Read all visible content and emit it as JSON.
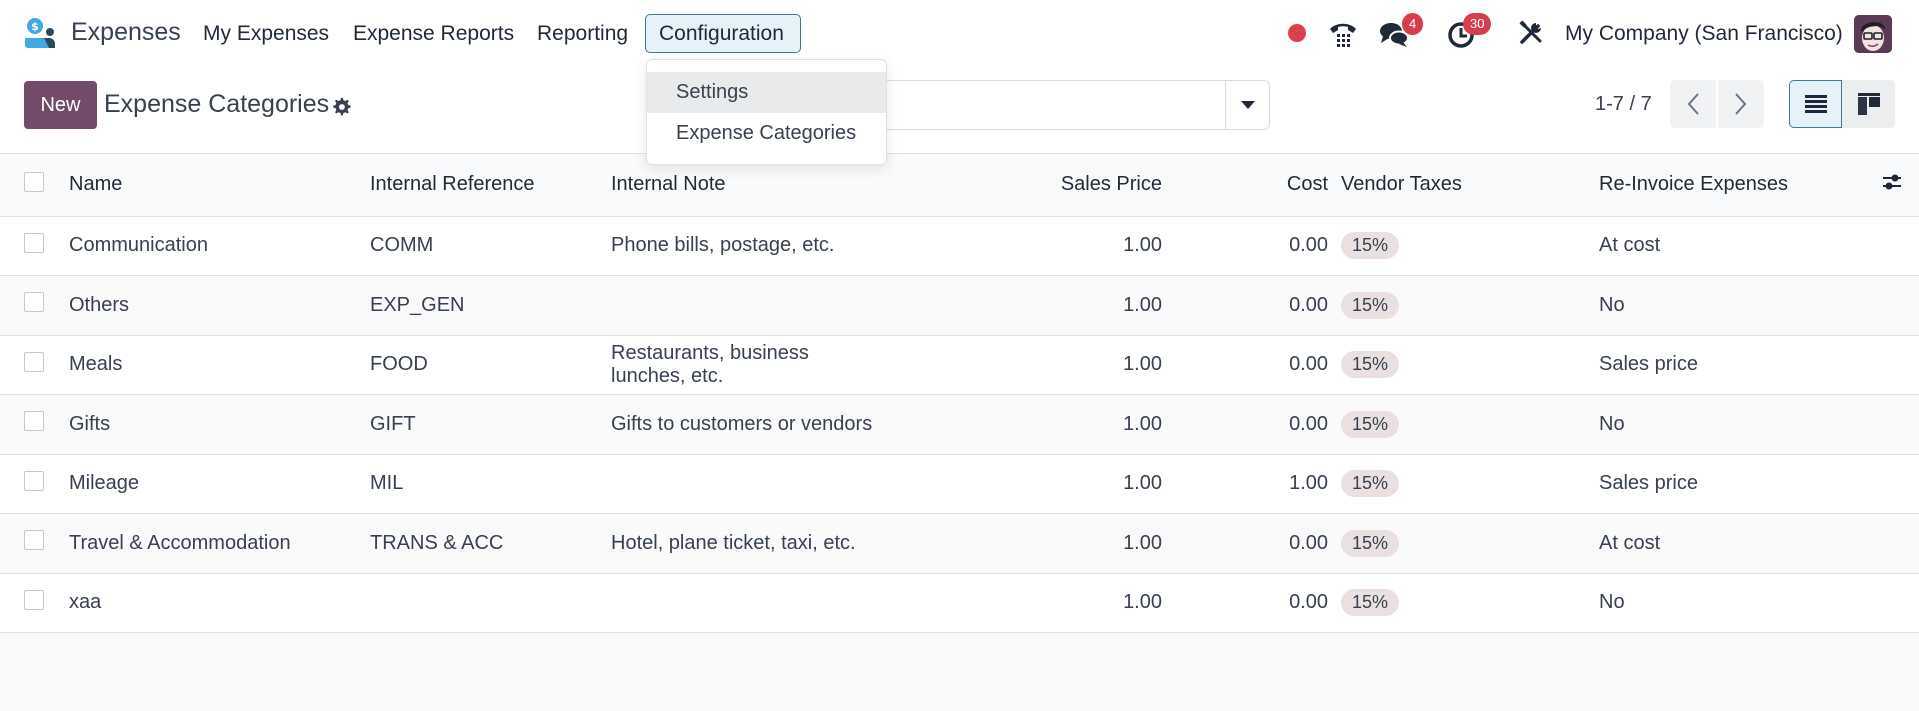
{
  "navbar": {
    "app_name": "Expenses",
    "menu": [
      {
        "label": "My Expenses"
      },
      {
        "label": "Expense Reports"
      },
      {
        "label": "Reporting"
      },
      {
        "label": "Configuration"
      }
    ],
    "chat_badge": "4",
    "activity_badge": "30",
    "company": "My Company (San Francisco)",
    "icons": {
      "logo": "expenses-app-logo",
      "recording": "record-dot-icon",
      "phone": "phone-icon",
      "chat": "chat-bubbles-icon",
      "activity": "clock-icon",
      "debug": "tools-icon",
      "avatar": "user-avatar"
    },
    "colors": {
      "badge": "#d63e4d",
      "record": "#d9404a",
      "active_menu_bg": "#e6f2f7",
      "active_menu_border": "#3f7a91"
    }
  },
  "dropdown": {
    "items": [
      {
        "label": "Settings",
        "highlighted": true
      },
      {
        "label": "Expense Categories",
        "highlighted": false
      }
    ]
  },
  "control_panel": {
    "new_label": "New",
    "title": "Expense Categories",
    "search_placeholder": "",
    "pager": "1-7 / 7",
    "colors": {
      "primary": "#714b67"
    }
  },
  "table": {
    "headers": {
      "name": "Name",
      "ref": "Internal Reference",
      "note": "Internal Note",
      "price": "Sales Price",
      "cost": "Cost",
      "tax": "Vendor Taxes",
      "reinvoice": "Re-Invoice Expenses"
    },
    "rows": [
      {
        "name": "Communication",
        "ref": "COMM",
        "note": "Phone bills, postage, etc.",
        "price": "1.00",
        "cost": "0.00",
        "tax": "15%",
        "reinvoice": "At cost"
      },
      {
        "name": "Others",
        "ref": "EXP_GEN",
        "note": "",
        "price": "1.00",
        "cost": "0.00",
        "tax": "15%",
        "reinvoice": "No"
      },
      {
        "name": "Meals",
        "ref": "FOOD",
        "note": "Restaurants, business lunches, etc.",
        "price": "1.00",
        "cost": "0.00",
        "tax": "15%",
        "reinvoice": "Sales price"
      },
      {
        "name": "Gifts",
        "ref": "GIFT",
        "note": "Gifts to customers or vendors",
        "price": "1.00",
        "cost": "0.00",
        "tax": "15%",
        "reinvoice": "No"
      },
      {
        "name": "Mileage",
        "ref": "MIL",
        "note": "",
        "price": "1.00",
        "cost": "1.00",
        "tax": "15%",
        "reinvoice": "Sales price"
      },
      {
        "name": "Travel & Accommodation",
        "ref": "TRANS & ACC",
        "note": "Hotel, plane ticket, taxi, etc.",
        "price": "1.00",
        "cost": "0.00",
        "tax": "15%",
        "reinvoice": "At cost"
      },
      {
        "name": "xaa",
        "ref": "",
        "note": "",
        "price": "1.00",
        "cost": "0.00",
        "tax": "15%",
        "reinvoice": "No"
      }
    ],
    "colors": {
      "tag_bg": "#e9e0df"
    }
  }
}
